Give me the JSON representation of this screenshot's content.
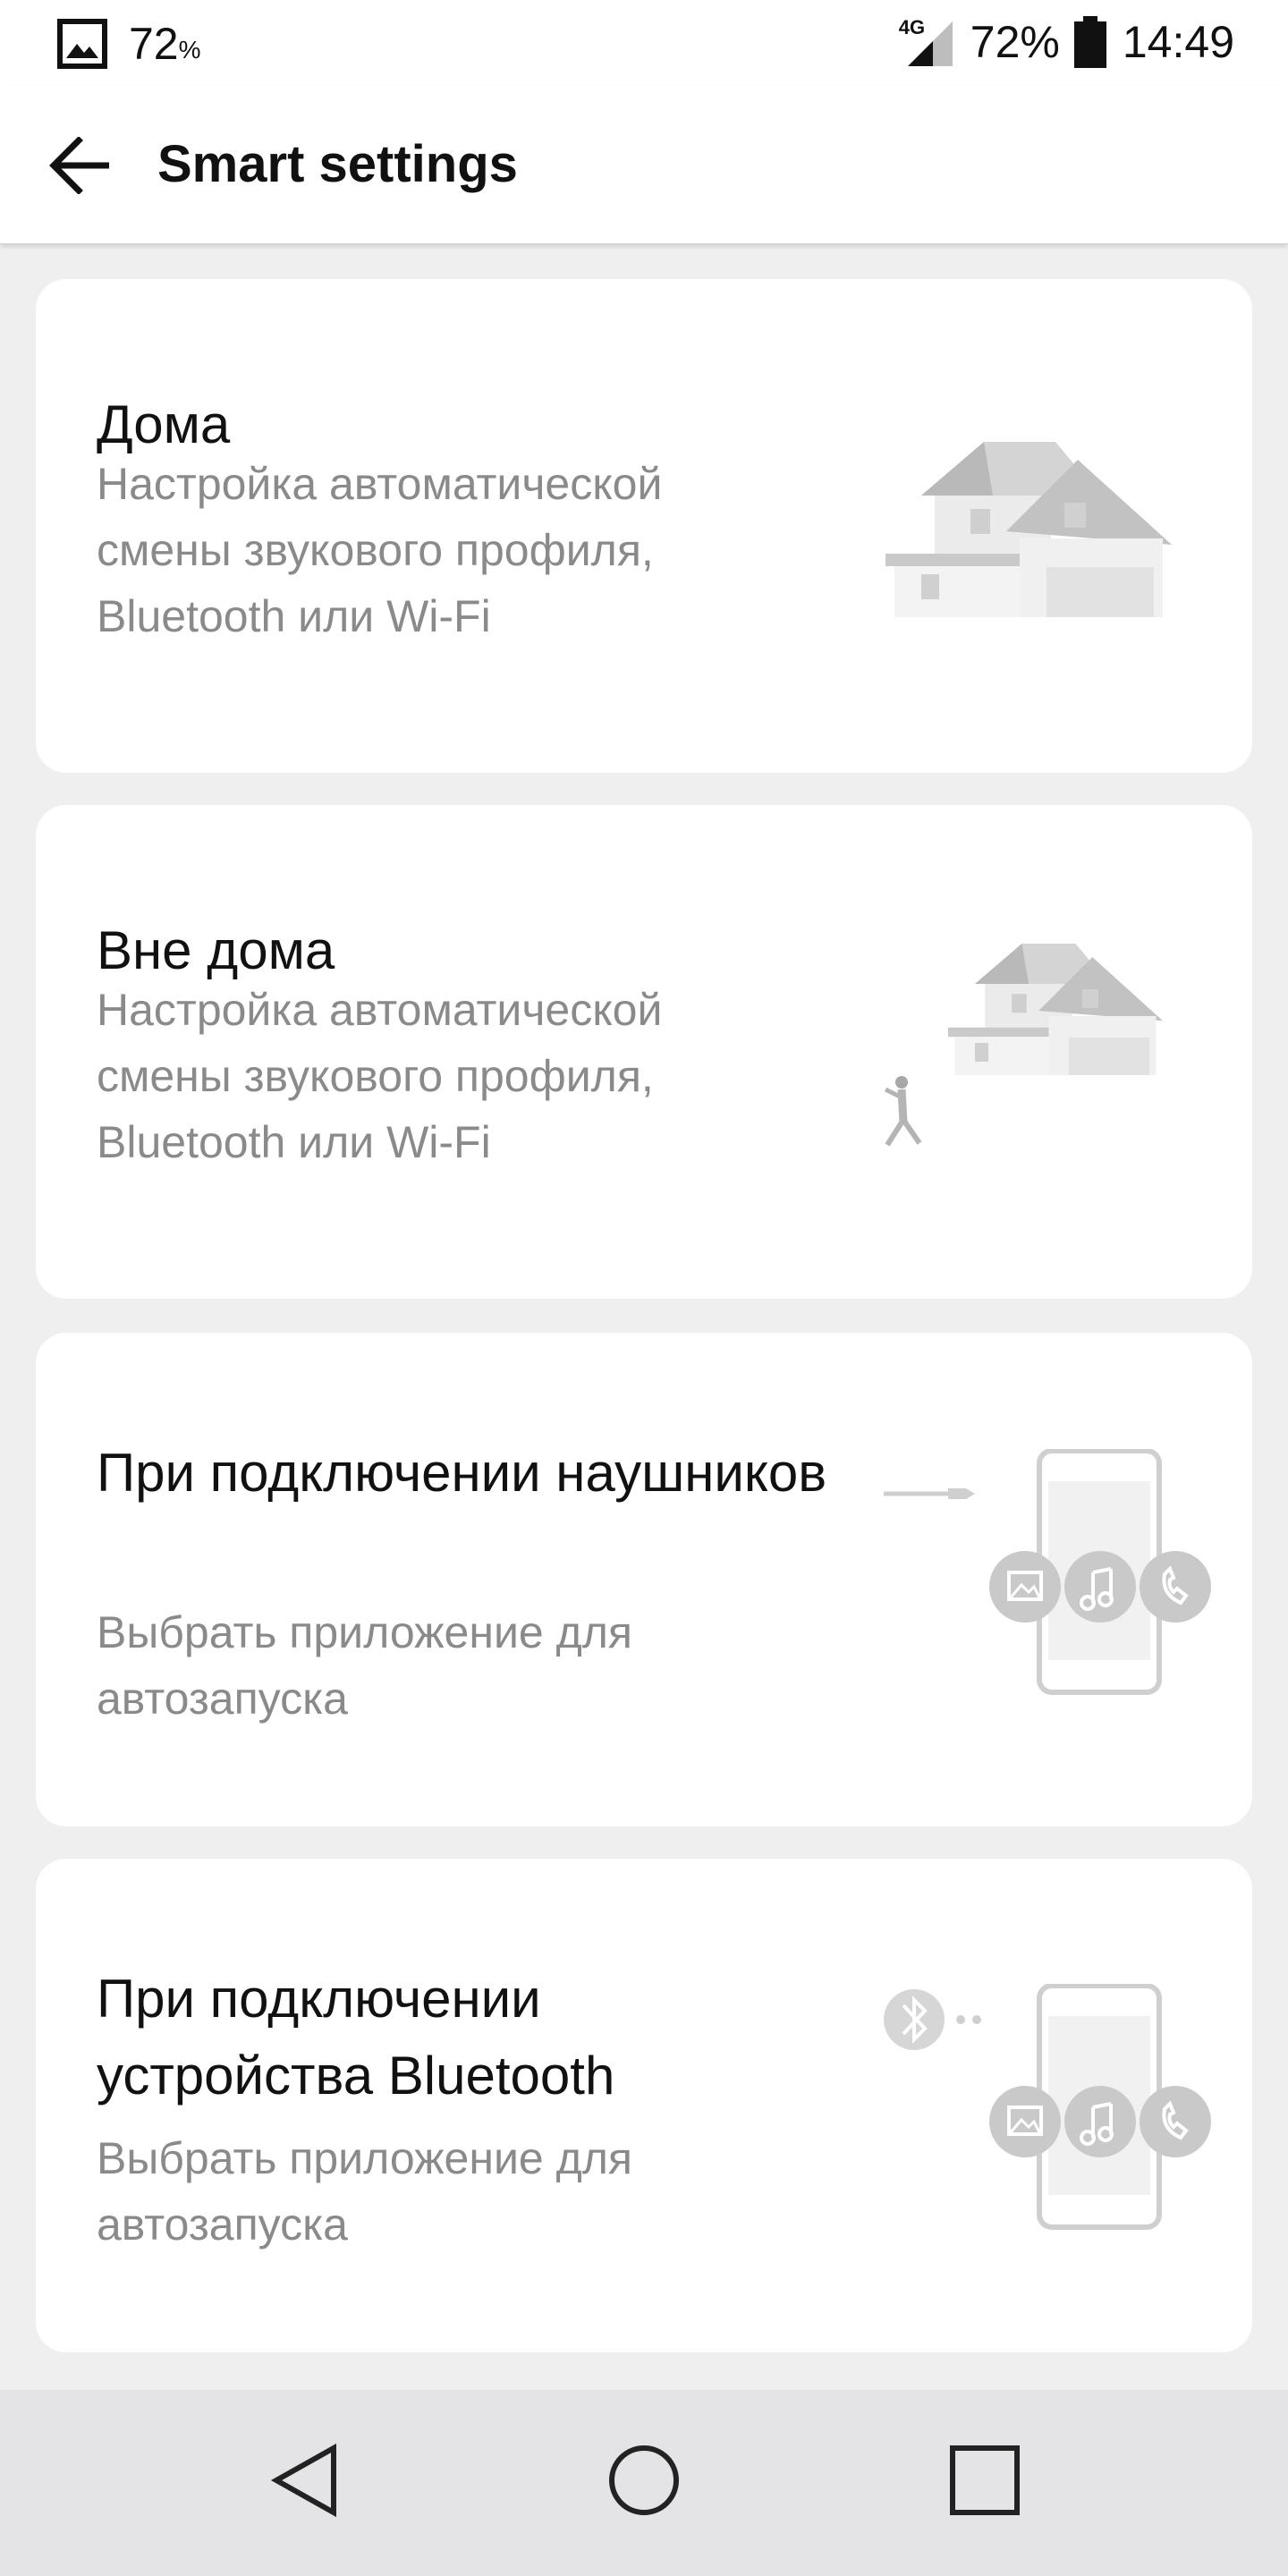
{
  "status_bar": {
    "left_percent": "72",
    "left_percent_unit": "%",
    "network": "4G",
    "battery_percent": "72%",
    "time": "14:49",
    "icons": [
      "image-icon",
      "signal-icon",
      "battery-icon"
    ]
  },
  "app_bar": {
    "title": "Smart settings",
    "back_icon": "arrow-back-icon"
  },
  "cards": [
    {
      "title": "Дома",
      "description": "Настройка автоматической смены звукового профиля, Bluetooth или Wi-Fi",
      "illustration": "house-icon"
    },
    {
      "title": "Вне дома",
      "description": "Настройка автоматической смены звукового профиля, Bluetooth или Wi-Fi",
      "illustration": "walking-away-from-house-icon"
    },
    {
      "title": "При подключении наушников",
      "description": "Выбрать приложение для автозапуска",
      "illustration": "headphones-phone-apps-icon"
    },
    {
      "title": "При подключении устройства Bluetooth",
      "description": "Выбрать приложение для автозапуска",
      "illustration": "bluetooth-phone-apps-icon"
    }
  ],
  "nav_bar": {
    "buttons": [
      "back-triangle-icon",
      "home-circle-icon",
      "recents-square-icon"
    ]
  },
  "colors": {
    "background": "#efefef",
    "card": "#ffffff",
    "title_text": "#111111",
    "secondary_text": "#8a8a8a",
    "illustration_gray": "#c8c8c8",
    "nav_bar": "#e4e4e6"
  }
}
